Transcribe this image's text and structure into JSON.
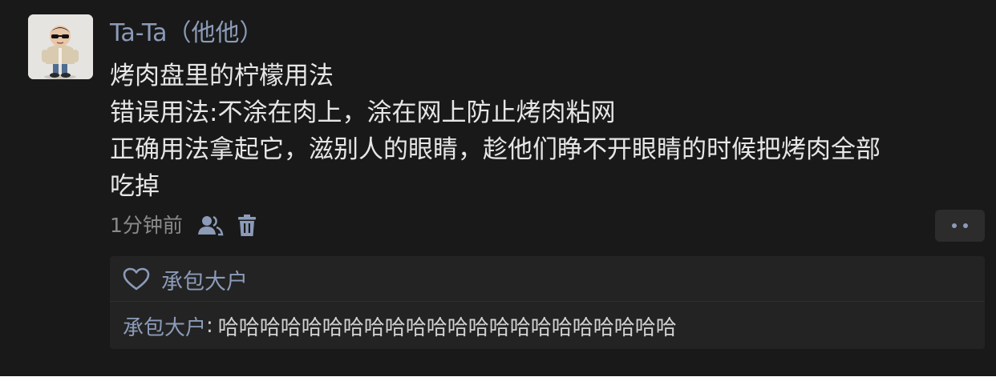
{
  "post": {
    "author": "Ta-Ta（他他）",
    "lines": [
      "烤肉盘里的柠檬用法",
      "错误用法:不涂在肉上，涂在网上防止烤肉粘网",
      "正确用法拿起它，滋别人的眼睛，趁他们睁不开眼睛的时候把烤肉全部",
      "吃掉"
    ],
    "time": "1分钟前",
    "icons": {
      "visibility": "friends-icon",
      "delete": "trash-icon",
      "more": "more-dots-icon"
    }
  },
  "interactions": {
    "like_icon": "heart-outline-icon",
    "likes": "承包大户",
    "comment": {
      "author": "承包大户",
      "separator": ":",
      "text": "哈哈哈哈哈哈哈哈哈哈哈哈哈哈哈哈哈哈哈哈哈哈"
    }
  },
  "colors": {
    "background": "#191919",
    "name_link": "#8b9bb8",
    "body_text": "#e6e6e6",
    "meta_text": "#8a8a8a",
    "panel": "#232323"
  }
}
